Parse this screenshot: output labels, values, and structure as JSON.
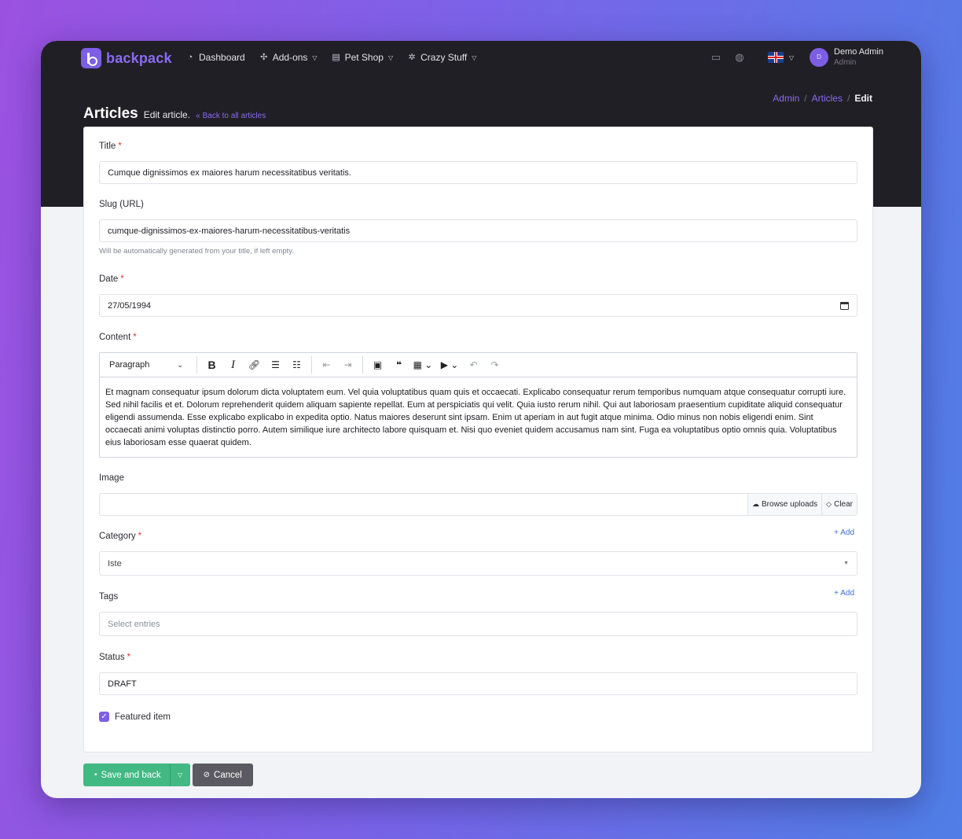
{
  "brand": {
    "name": "backpack"
  },
  "nav": {
    "items": [
      {
        "label": "Dashboard",
        "icon": "gauge-icon",
        "glyph": "◔",
        "dropdown": false
      },
      {
        "label": "Add-ons",
        "icon": "puzzle-icon",
        "glyph": "✣",
        "dropdown": true
      },
      {
        "label": "Pet Shop",
        "icon": "shop-icon",
        "glyph": "▤",
        "dropdown": true
      },
      {
        "label": "Crazy Stuff",
        "icon": "bug-icon",
        "glyph": "✲",
        "dropdown": true
      }
    ]
  },
  "user": {
    "initial": "D",
    "name": "Demo Admin",
    "role": "Admin"
  },
  "breadcrumb": {
    "admin": "Admin",
    "articles": "Articles",
    "current": "Edit",
    "sep": "/"
  },
  "header": {
    "title": "Articles",
    "subtitle": "Edit article.",
    "back": "Back to all articles",
    "back_glyph": "«"
  },
  "form": {
    "title": {
      "label": "Title",
      "required": "*",
      "value": "Cumque dignissimos ex maiores harum necessitatibus veritatis."
    },
    "slug": {
      "label": "Slug (URL)",
      "value": "cumque-dignissimos-ex-maiores-harum-necessitatibus-veritatis",
      "hint": "Will be automatically generated from your title, if left empty."
    },
    "date": {
      "label": "Date",
      "required": "*",
      "value": "27/05/1994"
    },
    "content": {
      "label": "Content",
      "required": "*",
      "format": "Paragraph",
      "text": "Et magnam consequatur ipsum dolorum dicta voluptatem eum. Vel quia voluptatibus quam quis et occaecati. Explicabo consequatur rerum temporibus numquam atque consequatur corrupti iure. Sed nihil facilis et et. Dolorum reprehenderit quidem aliquam sapiente repellat. Eum at perspiciatis qui velit. Quia iusto rerum nihil. Qui aut laboriosam praesentium cupiditate aliquid consequatur eligendi assumenda. Esse explicabo explicabo in expedita optio. Natus maiores deserunt sint ipsam. Enim ut aperiam in aut fugit atque minima. Odio minus non nobis eligendi enim. Sint occaecati animi voluptas distinctio porro. Autem similique iure architecto labore quisquam et. Nisi quo eveniet quidem accusamus nam sint. Fuga ea voluptatibus optio omnis quia. Voluptatibus eius laboriosam esse quaerat quidem."
    },
    "image": {
      "label": "Image",
      "browse": "Browse uploads",
      "clear": "Clear"
    },
    "category": {
      "label": "Category",
      "required": "*",
      "value": "Iste",
      "add": "+ Add"
    },
    "tags": {
      "label": "Tags",
      "placeholder": "Select entries",
      "add": "+ Add"
    },
    "status": {
      "label": "Status",
      "required": "*",
      "value": "DRAFT"
    },
    "featured": {
      "label": "Featured item",
      "checked": true
    }
  },
  "actions": {
    "save": "Save and back",
    "cancel": "Cancel"
  },
  "colors": {
    "accent": "#7c5fe6",
    "save": "#42b883",
    "cancel": "#5b5a62",
    "dark": "#211f26",
    "link": "#3f6fd8"
  }
}
